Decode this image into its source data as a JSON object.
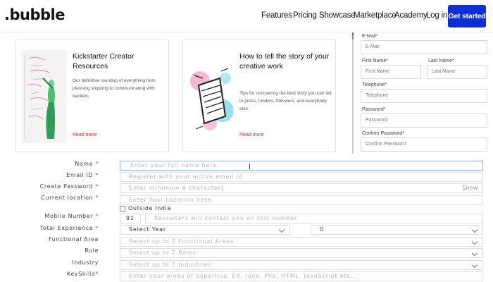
{
  "brand": {
    "logo": ".bubble",
    "accent": "#0d2ed6"
  },
  "nav": {
    "items": [
      "Features",
      "Pricing",
      "Showcase",
      "Marketplace",
      "Academy",
      "Log in"
    ],
    "cta": "Get started"
  },
  "cards": [
    {
      "title": "Kickstarter Creator Resources",
      "desc": "Our definitive roundup of everything from planning shipping to communicating with backers.",
      "more": "Read more"
    },
    {
      "title": "How to tell the story of your creative work",
      "desc": "Tips for uncovering the best story you can tell to press, funders, followers, and everybody else.",
      "more": "Read more"
    }
  ],
  "signup": {
    "email_label": "E-Mail*",
    "email_ph": "E-Mail",
    "first_label": "First Name*",
    "first_ph": "First Name",
    "last_label": "Last Name*",
    "last_ph": "Last Name",
    "phone_label": "Telephone*",
    "phone_ph": "Telephone",
    "password_label": "Password*",
    "password_ph": "Password",
    "confirm_label": "Confirm Password*",
    "confirm_ph": "Confirm Password"
  },
  "form": {
    "name_label": "Name",
    "name_ph": "Enter your full name here",
    "email_label": "Email ID",
    "email_ph": "Register with your active email id",
    "password_label": "Create Password",
    "password_ph": "Enter minimum 6 characters",
    "show": "Show",
    "location_label": "Current location",
    "location_ph": "Enter Your Location here",
    "outside": "Outside India",
    "mobile_label": "Mobile Number",
    "country_code": "91",
    "mobile_ph": "Recruiters will contact you on this number",
    "experience_label": "Total Experience",
    "experience_value": "Select Year",
    "month_value": "0",
    "functional_label": "Functional Area",
    "functional_ph": "Select up to 2 Functional Areas",
    "role_label": "Role",
    "role_ph": "Select up to 2 Roles",
    "industry_label": "Industry",
    "industry_ph": "Select up to 2 Industries",
    "skills_label": "KeySkills",
    "skills_ph": "Enter your areas of expertise. EX: Java, Php, HTML, JavaScript etc...",
    "required_mark": "*"
  }
}
